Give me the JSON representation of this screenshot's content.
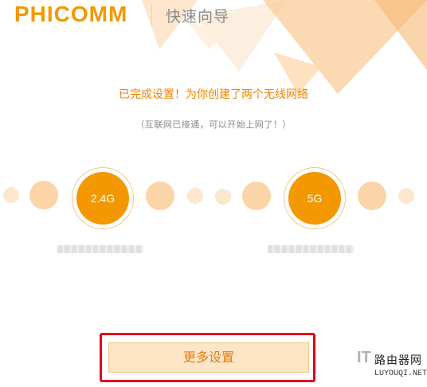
{
  "header": {
    "logo_text": "PHICOMM",
    "title": "快速向导"
  },
  "message": {
    "headline": "已完成设置！为你创建了两个无线网络",
    "subline": "（互联网已接通，可以开始上网了！）"
  },
  "bands": [
    {
      "label": "2.4G"
    },
    {
      "label": "5G"
    }
  ],
  "actions": {
    "more_settings": "更多设置"
  },
  "watermark": {
    "brand": "IT",
    "cn": "路由器网",
    "url": "LUYOUQI.NET"
  },
  "colors": {
    "accent": "#f39800",
    "headline": "#f08300",
    "highlight_box": "#e5001b",
    "button_bg": "#fde5c6"
  }
}
